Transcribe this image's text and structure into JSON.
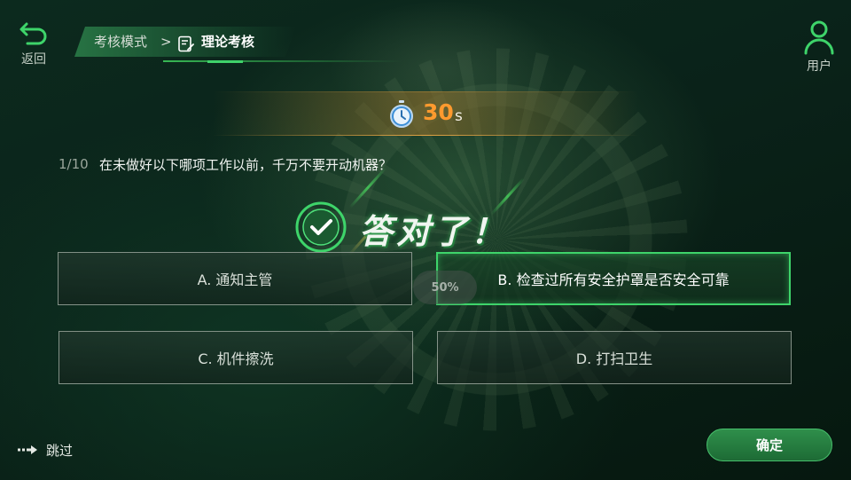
{
  "nav": {
    "back_label": "返回",
    "user_label": "用户"
  },
  "breadcrumb": {
    "root": "考核模式",
    "separator": ">",
    "current": "理论考核",
    "current_icon": "exam-sheet-icon"
  },
  "timer": {
    "value": "30",
    "unit": "s",
    "icon": "stopwatch-icon"
  },
  "question": {
    "progress": "1/10",
    "text": "在未做好以下哪项工作以前，千万不要开动机器？"
  },
  "feedback": {
    "text": "答对了！",
    "icon": "check-circle-icon"
  },
  "options": [
    {
      "label": "A. 通知主管",
      "state": "normal"
    },
    {
      "label": "B. 检查过所有安全护罩是否安全可靠",
      "state": "correct"
    },
    {
      "label": "C. 机件擦洗",
      "state": "normal"
    },
    {
      "label": "D. 打扫卫生",
      "state": "normal"
    }
  ],
  "answer_rate": "50%",
  "footer": {
    "skip_label": "跳过",
    "confirm_label": "确定"
  },
  "colors": {
    "accent": "#3ed46a",
    "timer": "#ff9a2e",
    "background": "#0a2219"
  }
}
